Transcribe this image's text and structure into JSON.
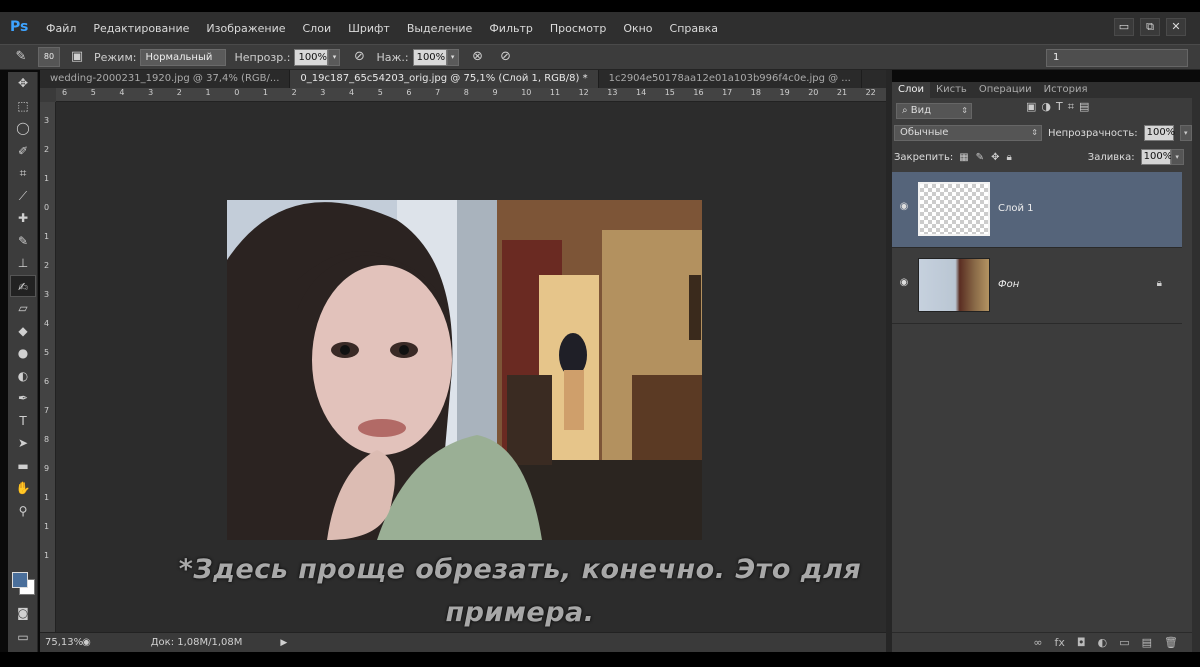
{
  "app": {
    "logo": "Ps",
    "window_controls": [
      "▭",
      "⧉",
      "✕"
    ]
  },
  "menu": [
    "Файл",
    "Редактирование",
    "Изображение",
    "Слои",
    "Шрифт",
    "Выделение",
    "Фильтр",
    "Просмотр",
    "Окно",
    "Справка"
  ],
  "options": {
    "brush_size": "80",
    "mode_label": "Режим:",
    "mode_value": "Нормальный",
    "opacity_label": "Непрозр.:",
    "opacity_value": "100%",
    "pressure_label": "Наж.:",
    "pressure_value": "100%",
    "workspace": "1"
  },
  "tabs": [
    {
      "label": "wedding-2000231_1920.jpg @ 37,4% (RGB/...",
      "active": false
    },
    {
      "label": "0_19c187_65c54203_orig.jpg @ 75,1% (Слой 1, RGB/8) *",
      "active": true
    },
    {
      "label": "1c2904e50178aa12e01a103b996f4c0e.jpg @ ...",
      "active": false
    }
  ],
  "ruler_h": [
    "6",
    "5",
    "4",
    "3",
    "2",
    "1",
    "0",
    "1",
    "2",
    "3",
    "4",
    "5",
    "6",
    "7",
    "8",
    "9",
    "10",
    "11",
    "12",
    "13",
    "14",
    "15",
    "16",
    "17",
    "18",
    "19",
    "20",
    "21",
    "22"
  ],
  "ruler_v": [
    "3",
    "2",
    "1",
    "0",
    "1",
    "2",
    "3",
    "4",
    "5",
    "6",
    "7",
    "8",
    "9",
    "1",
    "1",
    "1"
  ],
  "subtitle": "*Здесь проще обрезать, конечно. Это для примера.",
  "status": {
    "zoom": "75,13%",
    "doc": "Док: 1,08M/1,08M"
  },
  "layers_panel": {
    "tabs": [
      "Слои",
      "Кисть",
      "Операции",
      "История"
    ],
    "filter_label": "Вид",
    "blend_mode": "Обычные",
    "opacity_label": "Непрозрачность:",
    "opacity_value": "100%",
    "lock_label": "Закрепить:",
    "fill_label": "Заливка:",
    "fill_value": "100%",
    "layers": [
      {
        "name": "Слой 1",
        "selected": true
      },
      {
        "name": "Фон",
        "selected": false
      }
    ]
  }
}
